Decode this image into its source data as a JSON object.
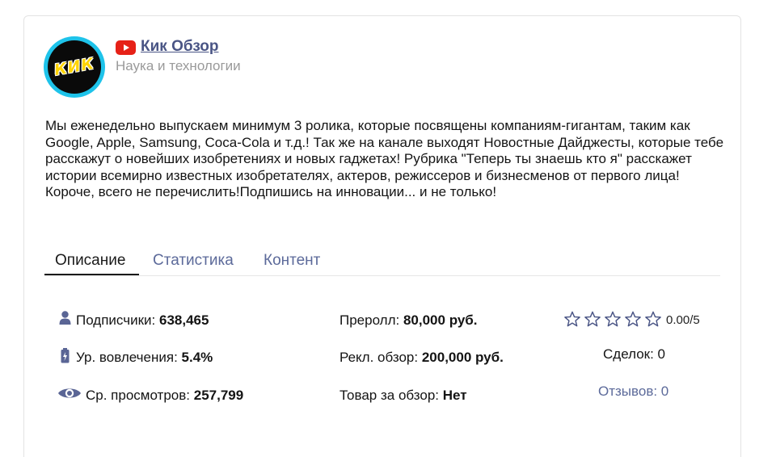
{
  "channel": {
    "logo_text": "КИК",
    "platform_icon": "youtube-icon",
    "name": "Кик Обзор",
    "category": "Наука и технологии",
    "description": "Мы еженедельно выпускаем минимум 3 ролика, которые посвящены компаниям-гигантам, таким как Google, Apple, Samsung, Coca-Cola и т.д.! Так же на канале выходят Новостные Дайджесты, которые тебе расскажут о новейших изобретениях и новых гаджетах! Рубрика \"Теперь ты знаешь кто я\" расскажет истории всемирно известных изобретателях, актеров, режиссеров и бизнесменов от первого лица! Короче, всего не перечислить!Подпишись на инновации... и не только!"
  },
  "tabs": [
    {
      "label": "Описание",
      "active": true
    },
    {
      "label": "Статистика",
      "active": false
    },
    {
      "label": "Контент",
      "active": false
    }
  ],
  "stats": {
    "subscribers": {
      "icon": "user-icon",
      "label": "Подписчики:",
      "value": "638,465"
    },
    "engagement": {
      "icon": "battery-icon",
      "label": "Ур. вовлечения:",
      "value": "5.4%"
    },
    "avg_views": {
      "icon": "eye-icon",
      "label": "Ср. просмотров:",
      "value": "257,799"
    },
    "preroll": {
      "label": "Преролл:",
      "value": "80,000 руб."
    },
    "ad_review": {
      "label": "Рекл. обзор:",
      "value": "200,000 руб."
    },
    "product_review": {
      "label": "Товар за обзор:",
      "value": "Нет"
    }
  },
  "rating": {
    "stars_filled": 0,
    "stars_total": 5,
    "text": "0.00/5"
  },
  "deals": "Сделок: 0",
  "reviews": "Отзывов: 0",
  "colors": {
    "accent": "#5c6a9a",
    "avatar_ring": "#1ec3ea",
    "youtube": "#e62117",
    "logo": "#ffd400"
  }
}
